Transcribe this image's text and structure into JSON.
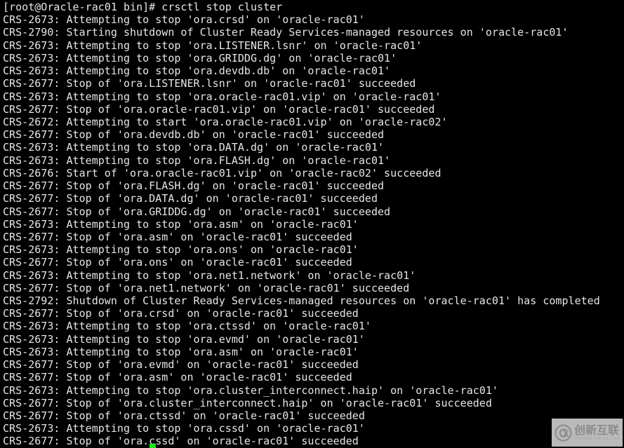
{
  "terminal": {
    "background_color": "#000000",
    "text_color": "#e6e6e6",
    "cursor_color": "#19e619",
    "prompt": "[root@Oracle-rac01 bin]#",
    "command": "crsctl stop cluster",
    "lines": [
      "[root@Oracle-rac01 bin]# crsctl stop cluster",
      "CRS-2673: Attempting to stop 'ora.crsd' on 'oracle-rac01'",
      "CRS-2790: Starting shutdown of Cluster Ready Services-managed resources on 'oracle-rac01'",
      "CRS-2673: Attempting to stop 'ora.LISTENER.lsnr' on 'oracle-rac01'",
      "CRS-2673: Attempting to stop 'ora.GRIDDG.dg' on 'oracle-rac01'",
      "CRS-2673: Attempting to stop 'ora.devdb.db' on 'oracle-rac01'",
      "CRS-2677: Stop of 'ora.LISTENER.lsnr' on 'oracle-rac01' succeeded",
      "CRS-2673: Attempting to stop 'ora.oracle-rac01.vip' on 'oracle-rac01'",
      "CRS-2677: Stop of 'ora.oracle-rac01.vip' on 'oracle-rac01' succeeded",
      "CRS-2672: Attempting to start 'ora.oracle-rac01.vip' on 'oracle-rac02'",
      "CRS-2677: Stop of 'ora.devdb.db' on 'oracle-rac01' succeeded",
      "CRS-2673: Attempting to stop 'ora.DATA.dg' on 'oracle-rac01'",
      "CRS-2673: Attempting to stop 'ora.FLASH.dg' on 'oracle-rac01'",
      "CRS-2676: Start of 'ora.oracle-rac01.vip' on 'oracle-rac02' succeeded",
      "CRS-2677: Stop of 'ora.FLASH.dg' on 'oracle-rac01' succeeded",
      "CRS-2677: Stop of 'ora.DATA.dg' on 'oracle-rac01' succeeded",
      "CRS-2677: Stop of 'ora.GRIDDG.dg' on 'oracle-rac01' succeeded",
      "CRS-2673: Attempting to stop 'ora.asm' on 'oracle-rac01'",
      "CRS-2677: Stop of 'ora.asm' on 'oracle-rac01' succeeded",
      "CRS-2673: Attempting to stop 'ora.ons' on 'oracle-rac01'",
      "CRS-2677: Stop of 'ora.ons' on 'oracle-rac01' succeeded",
      "CRS-2673: Attempting to stop 'ora.net1.network' on 'oracle-rac01'",
      "CRS-2677: Stop of 'ora.net1.network' on 'oracle-rac01' succeeded",
      "CRS-2792: Shutdown of Cluster Ready Services-managed resources on 'oracle-rac01' has completed",
      "CRS-2677: Stop of 'ora.crsd' on 'oracle-rac01' succeeded",
      "CRS-2673: Attempting to stop 'ora.ctssd' on 'oracle-rac01'",
      "CRS-2673: Attempting to stop 'ora.evmd' on 'oracle-rac01'",
      "CRS-2673: Attempting to stop 'ora.asm' on 'oracle-rac01'",
      "CRS-2677: Stop of 'ora.evmd' on 'oracle-rac01' succeeded",
      "CRS-2677: Stop of 'ora.asm' on 'oracle-rac01' succeeded",
      "CRS-2673: Attempting to stop 'ora.cluster_interconnect.haip' on 'oracle-rac01'",
      "CRS-2677: Stop of 'ora.cluster_interconnect.haip' on 'oracle-rac01' succeeded",
      "CRS-2677: Stop of 'ora.ctssd' on 'oracle-rac01' succeeded",
      "CRS-2673: Attempting to stop 'ora.cssd' on 'oracle-rac01'",
      "CRS-2677: Stop of 'ora.cssd' on 'oracle-rac01' succeeded"
    ]
  },
  "watermark": {
    "chinese": "创新互联",
    "pinyin": "CHUANG XIN HU LIAN",
    "color": "#8c8c8c"
  }
}
